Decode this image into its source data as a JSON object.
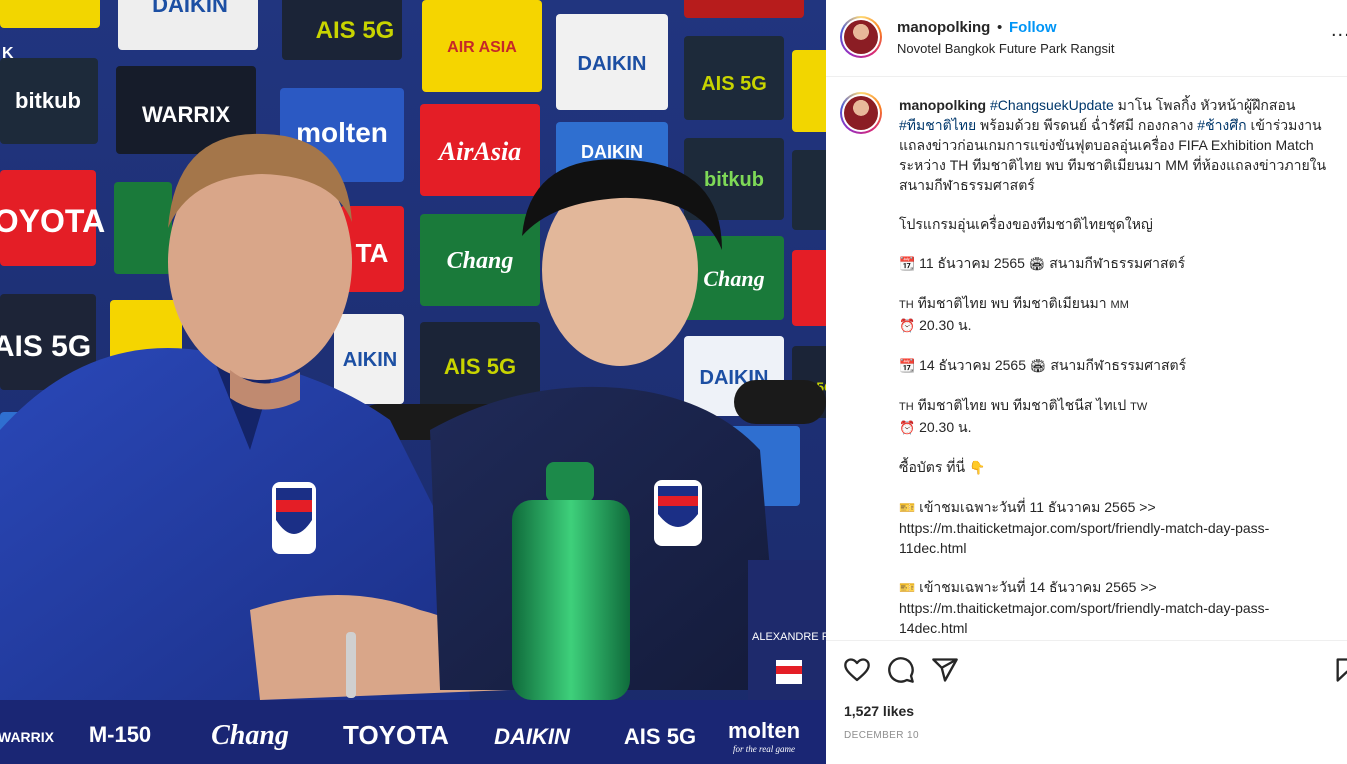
{
  "post": {
    "username": "manopolking",
    "separator": "•",
    "follow_label": "Follow",
    "location": "Novotel Bangkok Future Park Rangsit",
    "more_label": "..."
  },
  "photo": {
    "sponsors_top": [
      "DAIKIN",
      "AIS 5G",
      "AIR ASIA",
      "DAIKIN",
      "bitkub",
      "WARRIX",
      "molten",
      "AirAsia",
      "DAIKIN",
      "AIS 5G",
      "TOYOTA",
      "Chang",
      "TA",
      "AIS 5G",
      "bitkub",
      "AIS 5G",
      "AIKIN",
      "AIS 5G",
      "DAIKIN",
      "Chang",
      "olt"
    ],
    "corner_text": "K",
    "bottom_bar": [
      "WARRIX",
      "M-150",
      "Chang",
      "TOYOTA",
      "DAIKIN",
      "AIS 5G",
      "molten"
    ],
    "bottom_sub": "for the real game",
    "nameplate": "ALEXANDRE P"
  },
  "caption": {
    "username": "manopolking",
    "hashtag1": "#ChangsuekUpdate",
    "line1_rest": " มาโน โพลกิ้ง หัวหน้าผู้ฝึกสอน",
    "hashtag2": "#ทีมชาติไทย",
    "line2_rest": " พร้อมด้วย พีรดนย์ ฉ่ำรัศมี กองกลาง ",
    "hashtag3": "#ช้างศึก",
    "line2_end": " เข้าร่วมงาน",
    "line3": "แถลงข่าวก่อนเกมการแข่งขันฟุตบอลอุ่นเครื่อง FIFA Exhibition Match",
    "line4": "ระหว่าง TH ทีมชาติไทย พบ ทีมชาติเมียนมา MM ที่ห้องแถลงข่าวภายใน",
    "line5": "สนามกีฬาธรรมศาสตร์",
    "program_title": "โปรแกรมอุ่นเครื่องของทีมชาติไทยชุดใหญ่",
    "m1_date": "11 ธันวาคม 2565",
    "m1_venue": "สนามกีฬาธรรมศาสตร์",
    "m1_teams": "ทีมชาติไทย พบ ทีมชาติเมียนมา",
    "m1_flag1": "TH",
    "m1_flag2": "MM",
    "m1_time": "20.30 น.",
    "m2_date": "14 ธันวาคม 2565",
    "m2_venue": "สนามกีฬาธรรมศาสตร์",
    "m2_teams": "ทีมชาติไทย พบ ทีมชาติไชนีส ไทเป",
    "m2_flag1": "TH",
    "m2_flag2": "TW",
    "m2_time": "20.30 น.",
    "tickets": "ซื้อบัตร ที่นี่",
    "t1_text": "เข้าชมเฉพาะวันที่ 11 ธันวาคม 2565 >>",
    "t1_url_a": "https://m.thaiticketmajor.com/sport/friendly-match-day-pass-",
    "t1_url_b": "11dec.html",
    "t2_text": "เข้าชมเฉพาะวันที่ 14 ธันวาคม 2565 >>",
    "t2_url_a": "https://m.thaiticketmajor.com/sport/friendly-match-day-pass-",
    "t2_url_b": "14dec.html"
  },
  "icons": {
    "calendar": "calendar-icon",
    "stadium": "stadium-icon",
    "clock": "alarm-clock-icon",
    "point_down": "point-down-icon",
    "ticket": "ticket-icon",
    "like": "heart-icon",
    "comment": "comment-icon",
    "share": "share-icon",
    "save": "bookmark-icon"
  },
  "footer": {
    "likes": "1,527 likes",
    "date": "DECEMBER 10"
  },
  "colors": {
    "accent": "#0095f6",
    "hashtag": "#00376b",
    "muted": "#8e8e8e"
  }
}
